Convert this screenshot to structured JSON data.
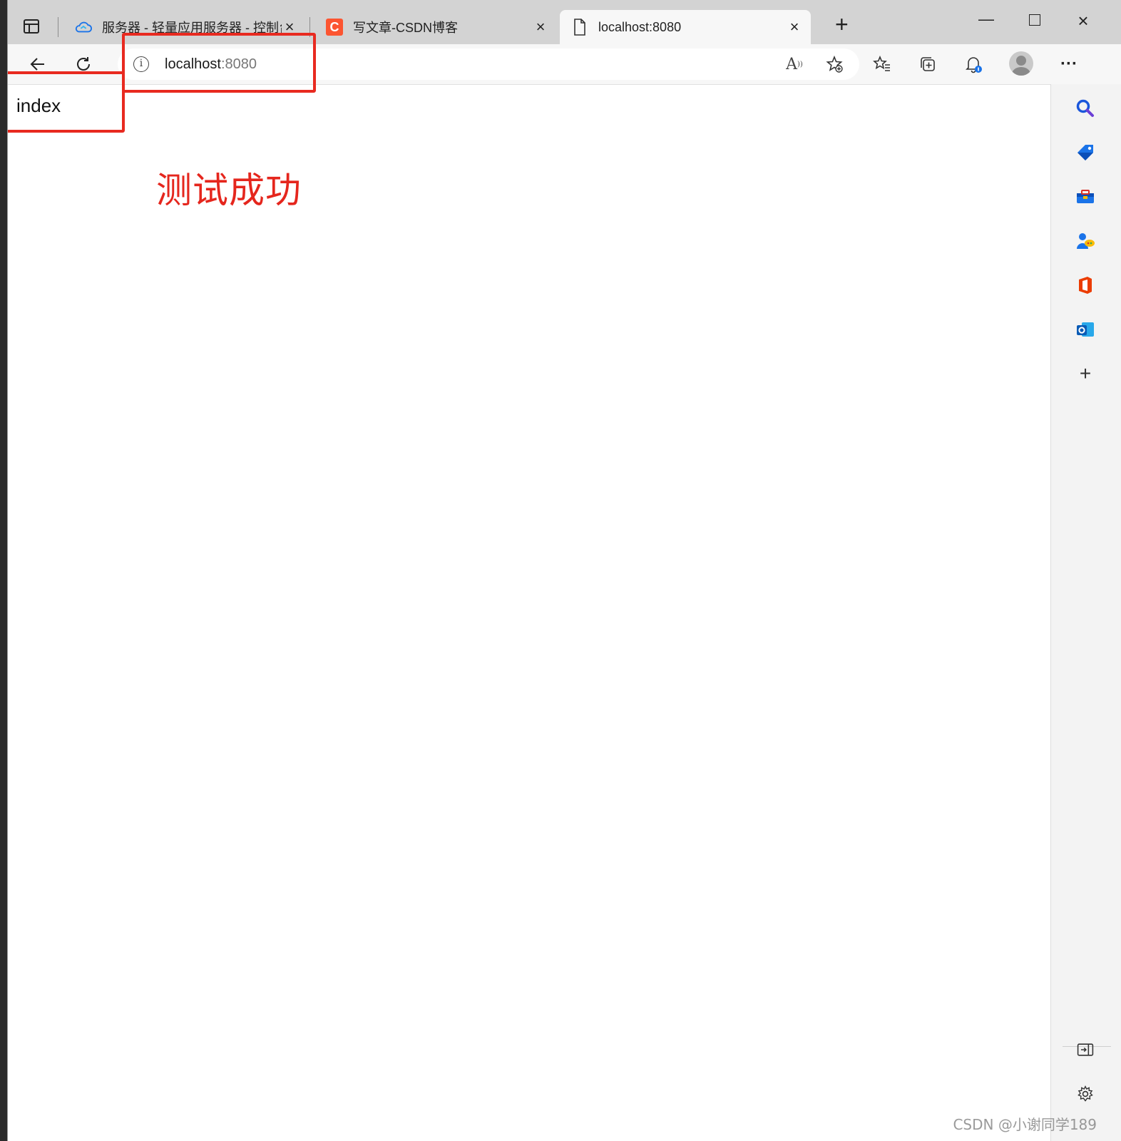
{
  "tabs": [
    {
      "title": "服务器 - 轻量应用服务器 - 控制台",
      "favicon": "cloud-icon",
      "active": false
    },
    {
      "title": "写文章-CSDN博客",
      "favicon": "csdn-icon",
      "favicon_letter": "C",
      "active": false
    },
    {
      "title": "localhost:8080",
      "favicon": "page-icon",
      "active": true
    }
  ],
  "address": {
    "host": "localhost",
    "port": ":8080"
  },
  "page": {
    "heading": "index"
  },
  "annotation": {
    "text": "测试成功",
    "color": "#e5261d"
  },
  "watermark": "CSDN @小谢同学189",
  "colors": {
    "highlight_box": "#e82a20",
    "csdn_brand": "#fc5531",
    "edge_blue": "#1a73e8"
  }
}
